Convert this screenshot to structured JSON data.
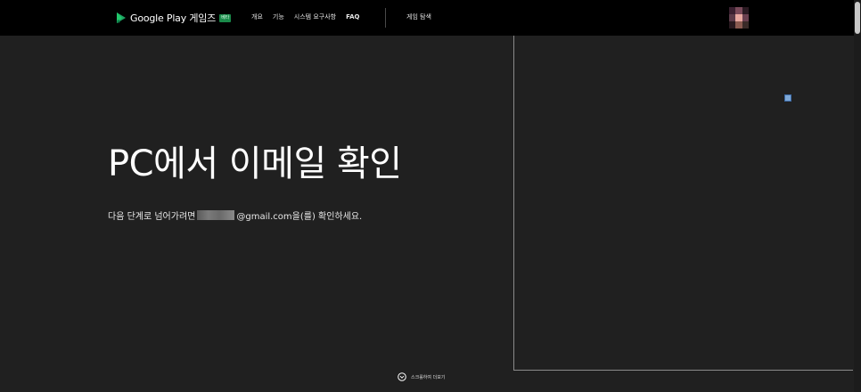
{
  "header": {
    "brand_name": "Google Play 게임즈",
    "beta_label": "베타",
    "nav_items": [
      {
        "label": "개요"
      },
      {
        "label": "기능"
      },
      {
        "label": "시스템 요구사항"
      },
      {
        "label": "FAQ"
      }
    ],
    "explore_label": "게임 탐색",
    "avatar_colors": [
      "#3a2030",
      "#7a4a5a",
      "#2a1a22",
      "#5a3a48",
      "#e8a8a0",
      "#6a4050",
      "#2a1a20",
      "#8a5a50",
      "#3a2a28"
    ]
  },
  "hero": {
    "title": "PC에서 이메일 확인",
    "desc_before": "다음 단계로 넘어가려면",
    "desc_after": "@gmail.com을(를) 확인하세요."
  },
  "footer": {
    "scroll_hint": "스크롤하여 더보기"
  },
  "colors": {
    "background": "#202020",
    "topbar": "#000000",
    "beta_badge": "#1a8a4a"
  }
}
